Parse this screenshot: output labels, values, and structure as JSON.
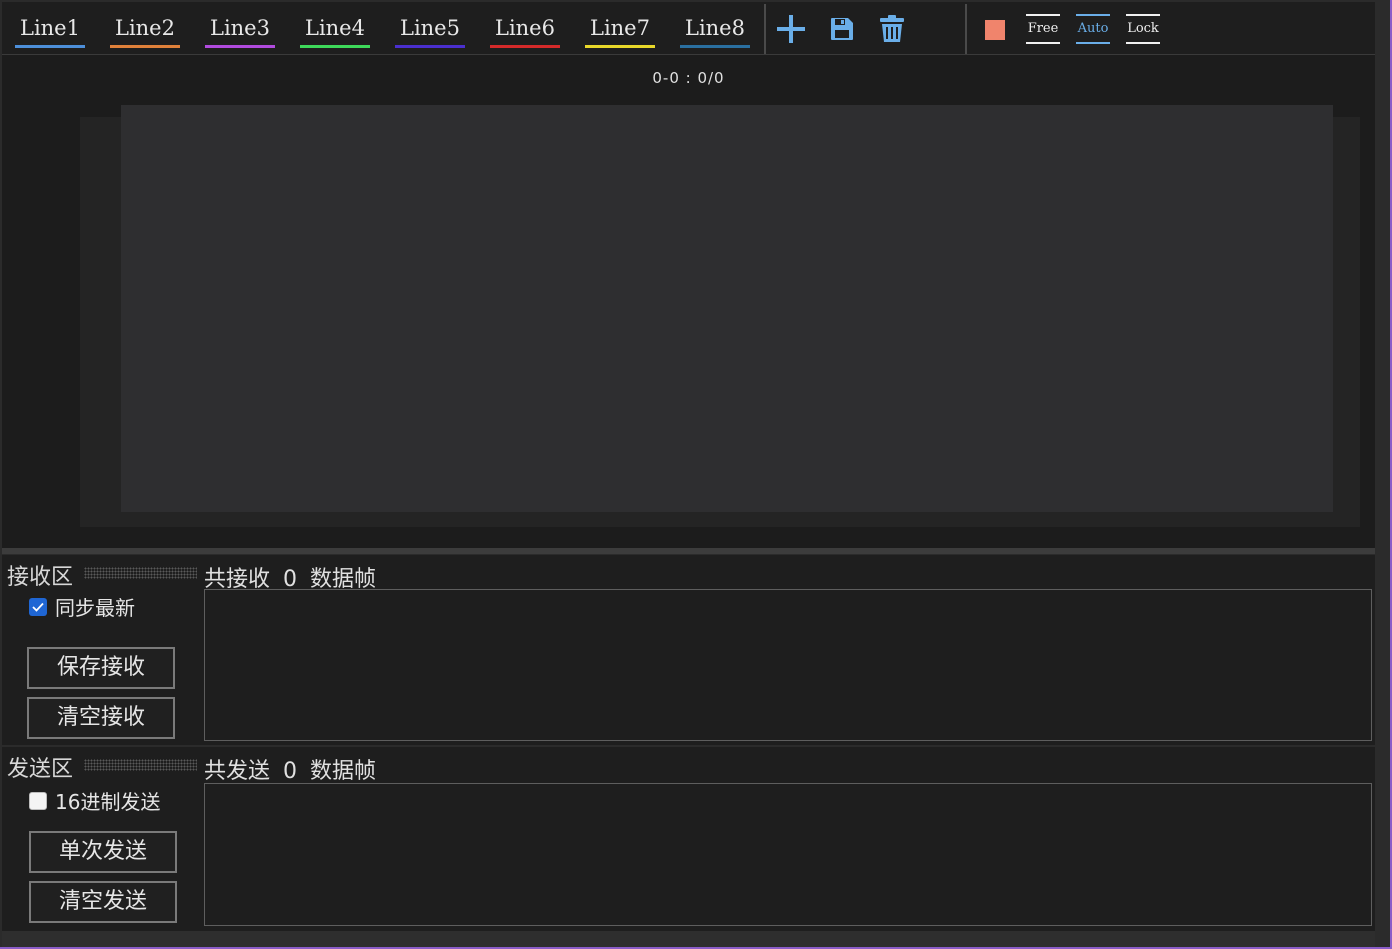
{
  "toolbar": {
    "tabs": [
      {
        "label": "Line1",
        "color": "#4d8fd9"
      },
      {
        "label": "Line2",
        "color": "#e0813a"
      },
      {
        "label": "Line3",
        "color": "#b14bde"
      },
      {
        "label": "Line4",
        "color": "#3ed95a"
      },
      {
        "label": "Line5",
        "color": "#4a2fcf"
      },
      {
        "label": "Line6",
        "color": "#d42a2a"
      },
      {
        "label": "Line7",
        "color": "#e8d82a"
      },
      {
        "label": "Line8",
        "color": "#2a6fa0"
      }
    ],
    "tools": {
      "add_icon": "plus-icon",
      "save_icon": "floppy-disk-icon",
      "delete_icon": "trash-icon",
      "icon_color": "#6aaee8"
    },
    "color_swatch": "#f0846c",
    "modes": [
      {
        "label": "Free",
        "color": "#f0f0f0"
      },
      {
        "label": "Auto",
        "color": "#6aaee8"
      },
      {
        "label": "Lock",
        "color": "#f0f0f0"
      }
    ]
  },
  "chart": {
    "coord_text": "0-0 : 0/0"
  },
  "receive": {
    "title": "接收区",
    "stat_prefix": "共接收",
    "count": "0",
    "stat_suffix": "数据帧",
    "sync_label": "同步最新",
    "sync_checked": true,
    "save_button": "保存接收",
    "clear_button": "清空接收"
  },
  "send": {
    "title": "发送区",
    "stat_prefix": "共发送",
    "count": "0",
    "stat_suffix": "数据帧",
    "hex_label": "16进制发送",
    "hex_checked": false,
    "single_button": "单次发送",
    "clear_button": "清空发送"
  }
}
